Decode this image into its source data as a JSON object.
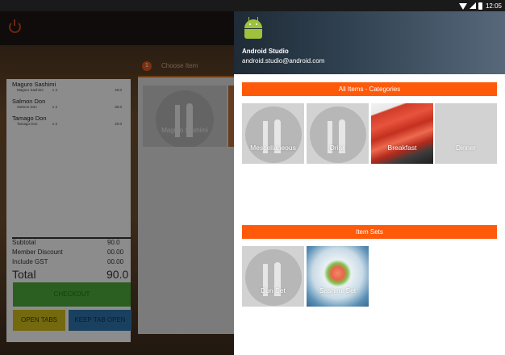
{
  "status_bar": {
    "time": "12:05"
  },
  "order": {
    "items": [
      {
        "name": "Maguro Sashimi",
        "sub_name": "Maguro Sashimi",
        "qty": "x 4",
        "amount": "40.0"
      },
      {
        "name": "Salmon Don",
        "sub_name": "Salmon Don",
        "qty": "x 2",
        "amount": "30.0"
      },
      {
        "name": "Tamago Don",
        "sub_name": "Tamago Don",
        "qty": "x 2",
        "amount": "20.0"
      }
    ],
    "subtotal_label": "Subtotal",
    "subtotal_value": "90.0",
    "discount_label": "Member Discount",
    "discount_value": "00.00",
    "gst_label": "Include GST",
    "gst_value": "00.00",
    "total_label": "Total",
    "total_value": "90.0",
    "checkout_label": "CHECKOUT",
    "open_tabs_label": "OPEN TABS",
    "keep_tab_label": "KEEP TAB OPEN"
  },
  "menu": {
    "step_badge": "1",
    "choose_label": "Choose Item",
    "tile_label": "Maguro Sashimi"
  },
  "drawer": {
    "user_name": "Android Studio",
    "user_email": "android.studio@android.com",
    "categories_header": "All Items - Categories",
    "categories": [
      {
        "label": "Mescellaneous",
        "image": "placeholder"
      },
      {
        "label": "Drink",
        "image": "placeholder"
      },
      {
        "label": "Breakfast",
        "image": "tuna-photo"
      },
      {
        "label": "Dinner",
        "image": "none"
      }
    ],
    "sets_header": "Item Sets",
    "sets": [
      {
        "label": "Don Set",
        "image": "placeholder"
      },
      {
        "label": "Sashimi Set",
        "image": "sashimi-photo"
      }
    ]
  },
  "colors": {
    "accent": "#ff5a0a",
    "checkout": "#4aa33a",
    "open_tabs": "#c8b619",
    "keep_tab": "#2d6fa6"
  }
}
